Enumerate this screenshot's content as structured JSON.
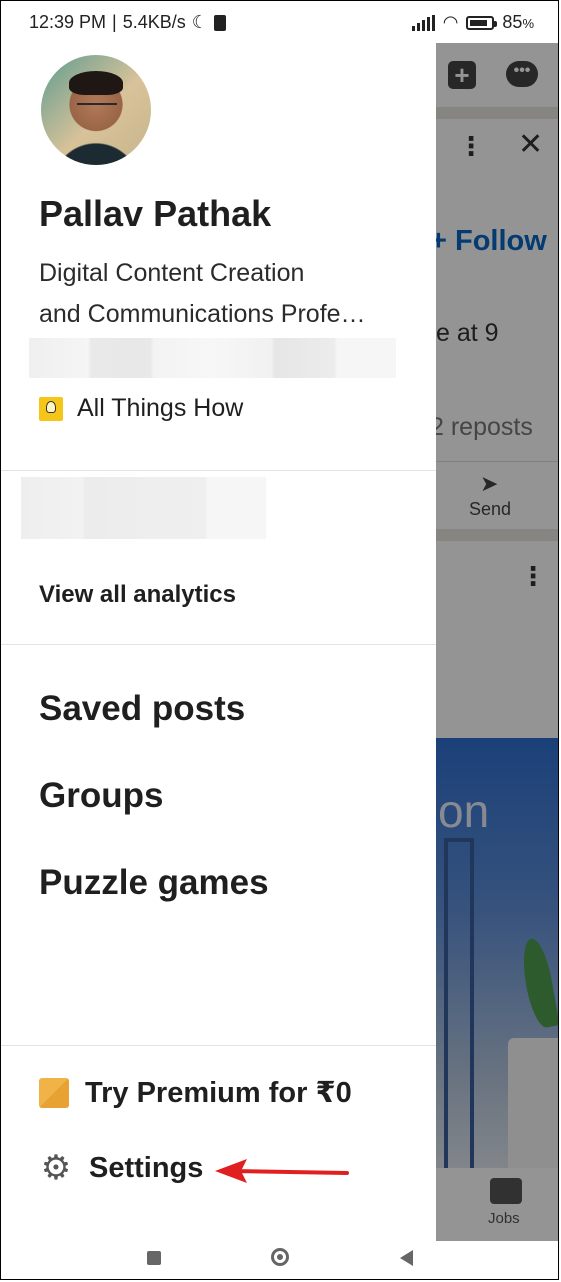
{
  "status": {
    "time": "12:39 PM",
    "speed": "5.4KB/s",
    "battery_percent": "85",
    "battery_unit": "%",
    "battery_level": 0.85
  },
  "feed": {
    "follow_label": "+ Follow",
    "text_snippet": "e at 9",
    "reposts": "2 reposts",
    "send_label": "Send",
    "image_text": "on",
    "jobs_label": "Jobs"
  },
  "profile": {
    "name": "Pallav Pathak",
    "headline_line1": "Digital Content Creation",
    "headline_line2": "and Communications Profe…",
    "company": "All Things How"
  },
  "analytics": {
    "view_all_label": "View all analytics"
  },
  "menu": {
    "items": [
      {
        "label": "Saved posts"
      },
      {
        "label": "Groups"
      },
      {
        "label": "Puzzle games"
      }
    ]
  },
  "bottom": {
    "premium_label": "Try Premium for ₹0",
    "settings_label": "Settings"
  },
  "colors": {
    "annotation_arrow": "#e02020",
    "image_blue": "#2f6fd0"
  }
}
